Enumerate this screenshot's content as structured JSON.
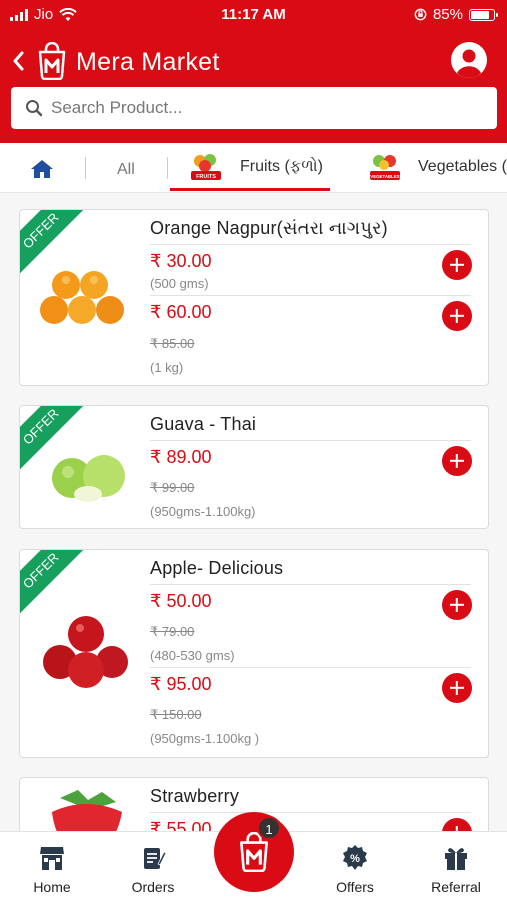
{
  "status_bar": {
    "carrier": "Jio",
    "time": "11:17 AM",
    "battery_percent": "85%",
    "battery_level": 0.85
  },
  "header": {
    "title": "Mera Market",
    "search_placeholder": "Search Product..."
  },
  "tabs": {
    "all_label": "All",
    "fruits_label": "Fruits (ફળો)",
    "fruits_badge": "FRUITS",
    "vegetables_label": "Vegetables (",
    "vegetables_badge": "VEGETABLES"
  },
  "products": [
    {
      "name": "Orange Nagpur(સંતરા નાગપુર)",
      "ribbon": "OFFER",
      "variants": [
        {
          "price": "₹ 30.00",
          "unit": "(500 gms)"
        },
        {
          "price": "₹ 60.00",
          "mrp": "₹ 85.00",
          "unit": "(1 kg)"
        }
      ]
    },
    {
      "name": "Guava - Thai",
      "ribbon": "OFFER",
      "variants": [
        {
          "price": "₹ 89.00",
          "mrp": "₹ 99.00",
          "unit": "(950gms-1.100kg)"
        }
      ]
    },
    {
      "name": "Apple- Delicious",
      "ribbon": "OFFER",
      "variants": [
        {
          "price": "₹ 50.00",
          "mrp": "₹ 79.00",
          "unit": "(480-530 gms)"
        },
        {
          "price": "₹ 95.00",
          "mrp": "₹ 150.00",
          "unit": "(950gms-1.100kg )"
        }
      ]
    },
    {
      "name": "Strawberry",
      "variants": [
        {
          "price": "₹ 55.00"
        }
      ]
    }
  ],
  "bottom_nav": {
    "home": "Home",
    "orders": "Orders",
    "cart_count": "1",
    "offers": "Offers",
    "referral": "Referral"
  },
  "colors": {
    "brand_red": "#d90b14",
    "offer_green": "#17a05d"
  }
}
